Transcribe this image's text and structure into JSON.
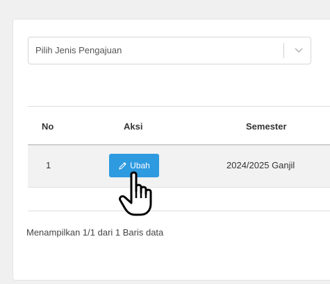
{
  "filter": {
    "placeholder": "Pilih Jenis Pengajuan",
    "icon": "chevron-down-icon"
  },
  "table": {
    "headers": [
      "No",
      "Aksi",
      "Semester"
    ],
    "rows": [
      {
        "no": "1",
        "action_label": "Ubah",
        "action_icon": "pencil-icon",
        "semester": "2024/2025 Ganjil"
      }
    ]
  },
  "pagination": {
    "info": "Menampilkan 1/1 dari 1 Baris data"
  },
  "colors": {
    "button": "#2e9ae0",
    "row_background": "#f2f2f2",
    "page_background": "#f0f0f0"
  }
}
